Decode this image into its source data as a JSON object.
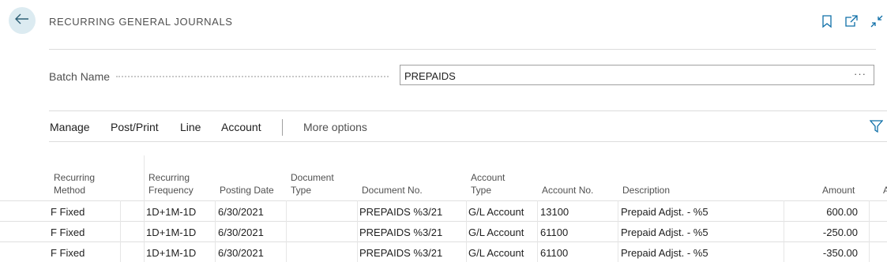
{
  "header": {
    "title": "RECURRING GENERAL JOURNALS"
  },
  "batch": {
    "label": "Batch Name",
    "value": "PREPAIDS",
    "ellipsis": "···"
  },
  "actions": {
    "manage": "Manage",
    "post_print": "Post/Print",
    "line": "Line",
    "account": "Account",
    "more": "More options"
  },
  "columns": {
    "recurring_method_1": "Recurring",
    "recurring_method_2": "Method",
    "recurring_frequency_1": "Recurring",
    "recurring_frequency_2": "Frequency",
    "posting_date": "Posting Date",
    "document_type_1": "Document",
    "document_type_2": "Type",
    "document_no": "Document No.",
    "account_type_1": "Account",
    "account_type_2": "Type",
    "account_no": "Account No.",
    "description": "Description",
    "amount": "Amount",
    "next_partial": "A"
  },
  "rows": [
    {
      "method": "F  Fixed",
      "frequency": "1D+1M-1D",
      "posting_date": "6/30/2021",
      "document_type": "",
      "document_no": "PREPAIDS %3/21",
      "account_type": "G/L Account",
      "account_no": "13100",
      "description": "Prepaid Adjst. - %5",
      "amount": "600.00"
    },
    {
      "method": "F  Fixed",
      "frequency": "1D+1M-1D",
      "posting_date": "6/30/2021",
      "document_type": "",
      "document_no": "PREPAIDS %3/21",
      "account_type": "G/L Account",
      "account_no": "61100",
      "description": "Prepaid Adjst. - %5",
      "amount": "-250.00"
    },
    {
      "method": "F  Fixed",
      "frequency": "1D+1M-1D",
      "posting_date": "6/30/2021",
      "document_type": "",
      "document_no": "PREPAIDS %3/21",
      "account_type": "G/L Account",
      "account_no": "61100",
      "description": "Prepaid Adjst. - %5",
      "amount": "-350.00"
    }
  ],
  "colors": {
    "accent": "#0f6fa8",
    "back_button_bg": "#dcebf1"
  },
  "icons": {
    "back": "arrow-left-icon",
    "bookmark": "bookmark-icon",
    "open_new_window": "open-new-window-icon",
    "collapse": "collapse-icon",
    "filter": "filter-icon"
  }
}
